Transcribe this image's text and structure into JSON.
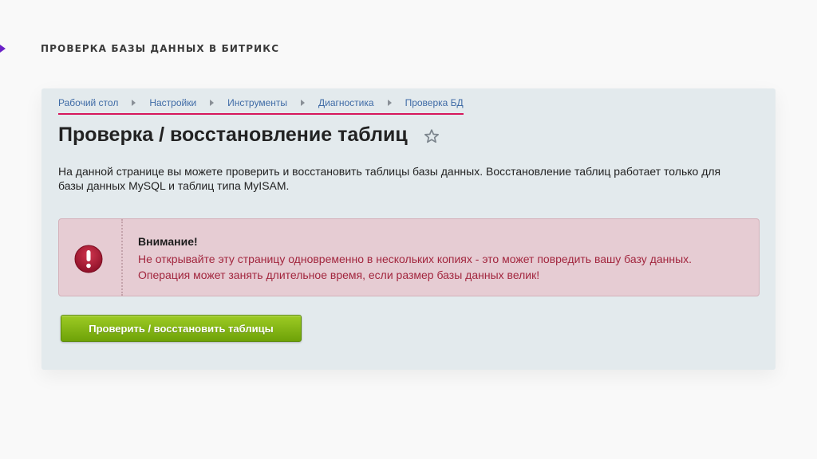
{
  "slide": {
    "title": "ПРОВЕРКА БАЗЫ ДАННЫХ В БИТРИКС",
    "accent_color": "#6b22c8"
  },
  "breadcrumb": {
    "items": [
      {
        "label": "Рабочий стол"
      },
      {
        "label": "Настройки"
      },
      {
        "label": "Инструменты"
      },
      {
        "label": "Диагностика"
      },
      {
        "label": "Проверка БД"
      }
    ],
    "underline_color": "#d6175c"
  },
  "page": {
    "title": "Проверка / восстановление таблиц",
    "favorite_icon": "star-icon",
    "description": "На данной странице вы можете проверить и восстановить таблицы базы данных. Восстановление таблиц работает только для базы данных MySQL и таблиц типа MyISAM."
  },
  "alert": {
    "icon": "exclamation-icon",
    "title": "Внимание!",
    "text": "Не открывайте эту страницу одновременно в нескольких копиях - это может повредить вашу базу данных. Операция может занять длительное время, если размер базы данных велик!",
    "text_color": "#a2263e"
  },
  "action": {
    "label": "Проверить / восстановить таблицы",
    "color": "#7fb512"
  }
}
